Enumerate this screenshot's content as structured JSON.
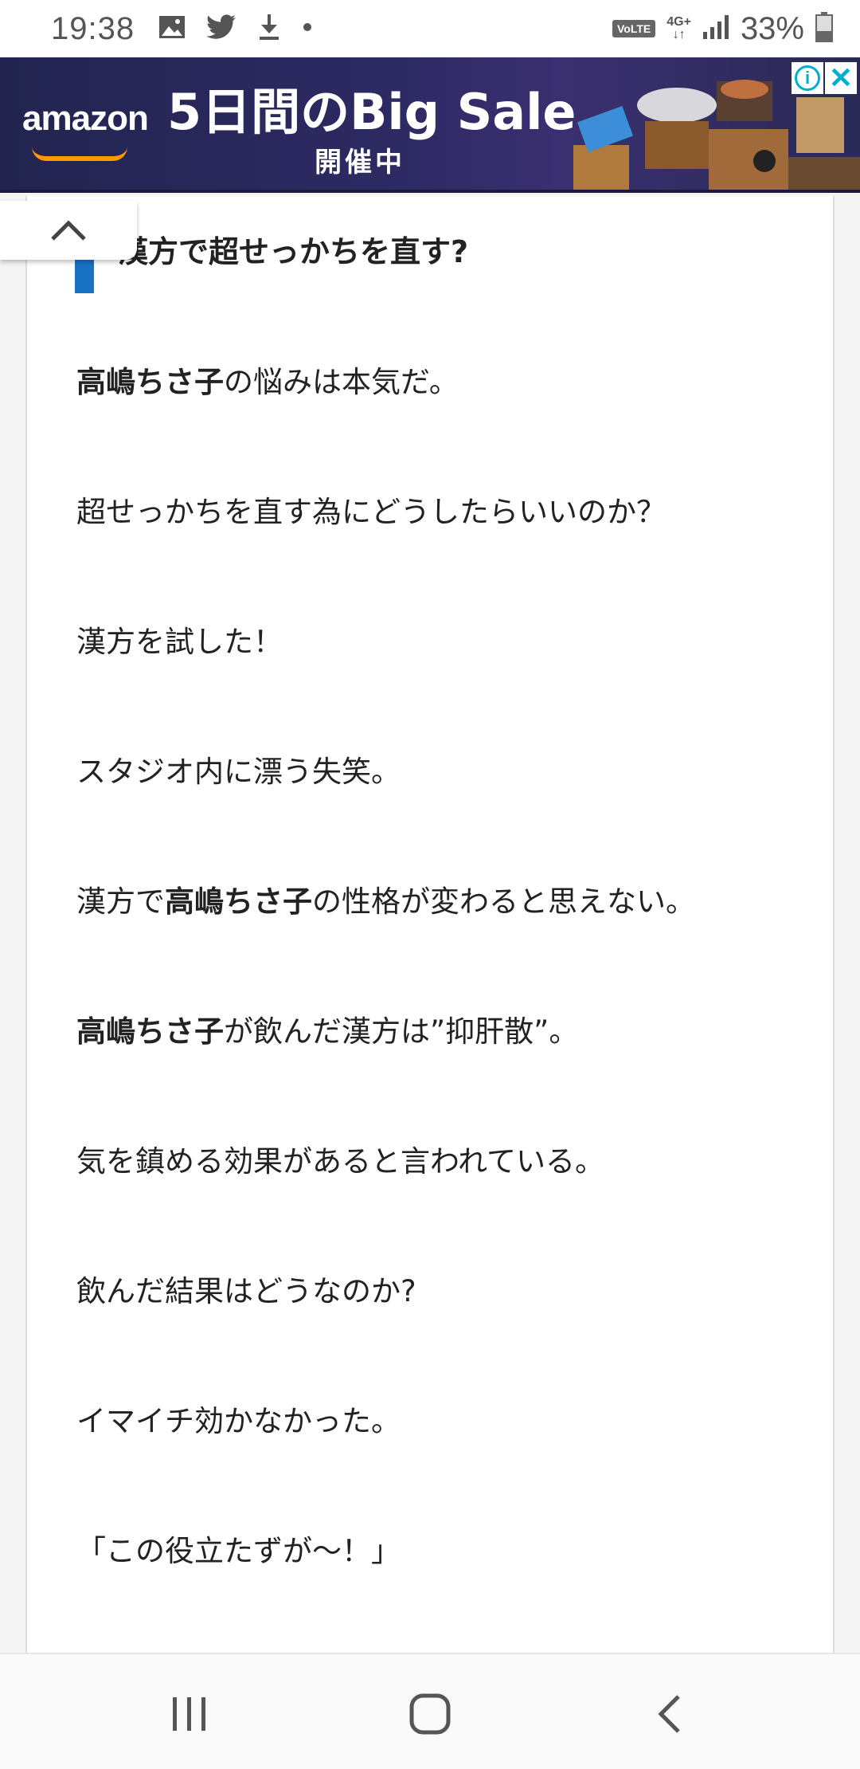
{
  "status_bar": {
    "time": "19:38",
    "left_icons": [
      "image-icon",
      "twitter-icon",
      "download-icon",
      "dot-icon"
    ],
    "volte": "VoLTE",
    "network": "4G+",
    "battery": "33%"
  },
  "ad": {
    "brand": "amazon",
    "headline": "5日間のBig Sale",
    "subline": "開催中",
    "info_icon": "info-icon",
    "close_icon": "close-icon"
  },
  "article": {
    "heading": "漢方で超せっかちを直す?",
    "accent_color": "#1a72c4",
    "paragraphs": [
      {
        "bold": "高嶋ちさ子",
        "pre": "",
        "post": "の悩みは本気だ。"
      },
      {
        "bold": "",
        "pre": "超せっかちを直す為にどうしたらいいのか？",
        "post": ""
      },
      {
        "bold": "",
        "pre": "漢方を試した！",
        "post": ""
      },
      {
        "bold": "",
        "pre": "スタジオ内に漂う失笑。",
        "post": ""
      },
      {
        "bold": "高嶋ちさ子",
        "pre": "漢方で",
        "post": "の性格が変わると思えない。"
      },
      {
        "bold": "高嶋ちさ子",
        "pre": "",
        "post": "が飲んだ漢方は”抑肝散”。"
      },
      {
        "bold": "",
        "pre": "気を鎮める効果があると言われている。",
        "post": ""
      },
      {
        "bold": "",
        "pre": "飲んだ結果はどうなのか?",
        "post": ""
      },
      {
        "bold": "",
        "pre": "イマイチ効かなかった。",
        "post": ""
      },
      {
        "bold": "",
        "pre": "「この役立たずが〜！」",
        "post": ""
      }
    ]
  },
  "nav_bar": {
    "recent_icon": "recent-apps-icon",
    "home_icon": "home-icon",
    "back_icon": "back-icon"
  }
}
